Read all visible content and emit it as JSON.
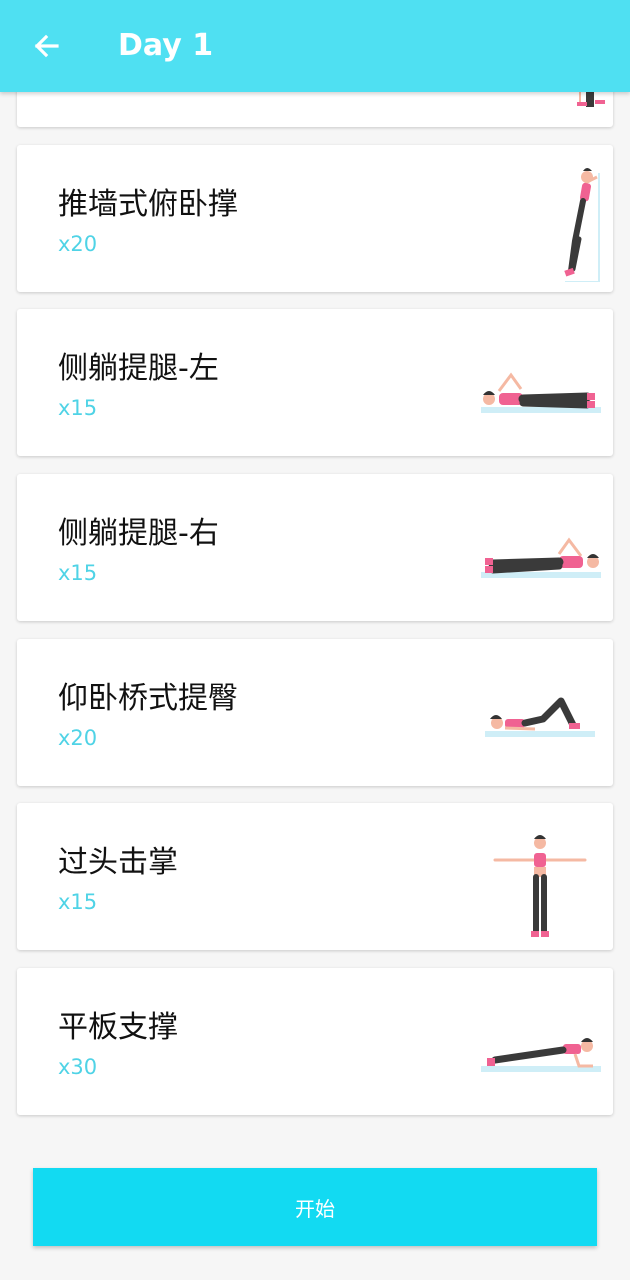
{
  "header": {
    "title": "Day 1",
    "back_icon": "arrow-left-icon",
    "background": "#4fe0f2"
  },
  "exercises": [
    {
      "name": "推墙式俯卧撑",
      "reps": "x20",
      "illustration": "wall-pushup-figure"
    },
    {
      "name": "侧躺提腿-左",
      "reps": "x15",
      "illustration": "side-lying-leg-raise-left-figure"
    },
    {
      "name": "侧躺提腿-右",
      "reps": "x15",
      "illustration": "side-lying-leg-raise-right-figure"
    },
    {
      "name": "仰卧桥式提臀",
      "reps": "x20",
      "illustration": "glute-bridge-figure"
    },
    {
      "name": "过头击掌",
      "reps": "x15",
      "illustration": "overhead-clap-figure"
    },
    {
      "name": "平板支撑",
      "reps": "x30",
      "illustration": "plank-figure"
    }
  ],
  "start_button": {
    "label": "开始",
    "color": "#12daf2"
  },
  "colors": {
    "accent": "#4fd3e6",
    "skin": "#f5b9a3",
    "top": "#f06292",
    "pants": "#3a3a3a",
    "mat": "#cfeef7"
  }
}
